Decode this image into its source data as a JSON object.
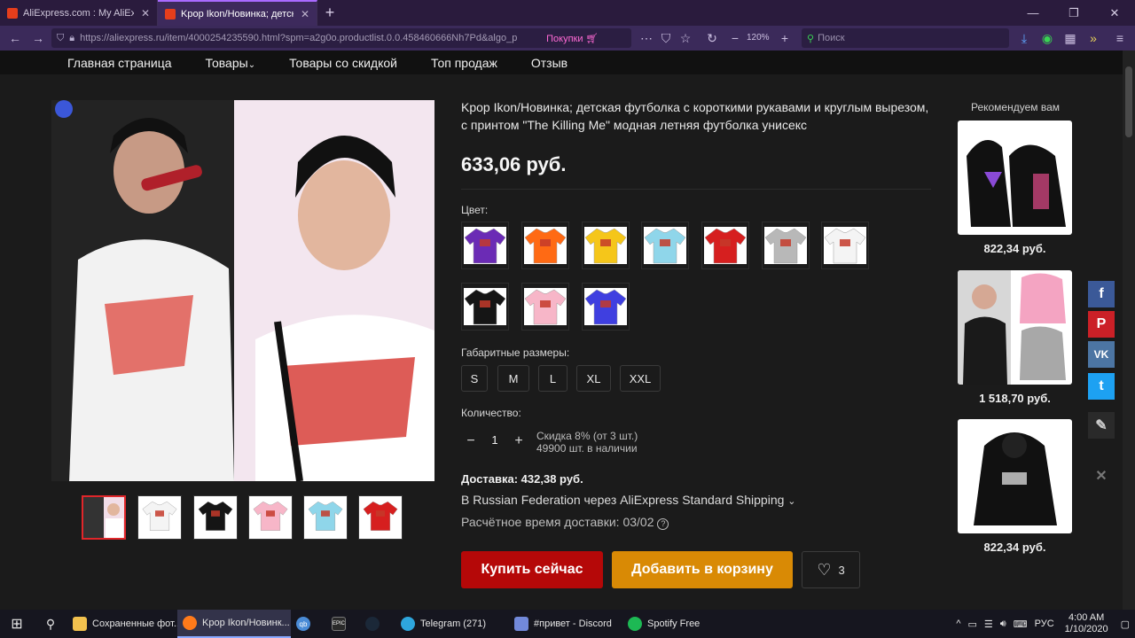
{
  "browser": {
    "tabs": [
      {
        "label": "AliExpress.com : My AliExpress"
      },
      {
        "label": "Kpop Ikon/Новинка; детская ф"
      }
    ],
    "url": "https://aliexpress.ru/item/4000254235590.html?spm=a2g0o.productlist.0.0.458460666Nh7Pd&algo_p",
    "shop_label": "Покупки",
    "zoom": "120%",
    "search_placeholder": "Поиск"
  },
  "site_nav": {
    "items": [
      "Главная страница",
      "Товары",
      "Товары со скидкой",
      "Топ продаж",
      "Отзыв"
    ]
  },
  "product": {
    "title": "Kpop Ikon/Новинка; детская футболка с короткими рукавами и круглым вырезом, с принтом \"The Killing Me\" модная летняя футболка унисекс",
    "price": "633,06 руб.",
    "color_label": "Цвет:",
    "colors": [
      "#6b2bb5",
      "#ff6a14",
      "#f5c61a",
      "#8fd6ea",
      "#d61f1f",
      "#b8b8b8",
      "#f4f4f4",
      "#151515",
      "#f7b6c8",
      "#3f3fe0"
    ],
    "size_label": "Габаритные размеры:",
    "sizes": [
      "S",
      "M",
      "L",
      "XL",
      "XXL"
    ],
    "qty_label": "Количество:",
    "qty": "1",
    "discount_text": "Скидка 8% (от 3 шт.)",
    "stock_text": "49900 шт. в наличии",
    "shipping_cost": "Доставка: 432,38 руб.",
    "shipping_via": "В Russian Federation через AliExpress Standard Shipping",
    "eta_label": "Расчётное время доставки: 03/02",
    "buy_now": "Купить сейчас",
    "add_to_cart": "Добавить в корзину",
    "wishlist_count": "3",
    "thumb_colors": [
      "#f4f4f4",
      "#151515",
      "#f7b6c8",
      "#8fd6ea",
      "#d61f1f"
    ]
  },
  "recommendations": {
    "title": "Рекомендуем вам",
    "items": [
      {
        "price": "822,34 руб."
      },
      {
        "price": "1 518,70 руб."
      },
      {
        "price": "822,34 руб."
      }
    ]
  },
  "taskbar": {
    "items": [
      {
        "label": "Сохраненные фот..."
      },
      {
        "label": "Kpop Ikon/Новинк..."
      },
      {
        "label": "qb"
      },
      {
        "label": "EPIC"
      },
      {
        "label": "Steam"
      },
      {
        "label": "Telegram (271)"
      },
      {
        "label": "#привет - Discord"
      },
      {
        "label": "Spotify Free"
      }
    ],
    "telegram_badge": "271",
    "lang": "РУС",
    "time": "4:00 AM",
    "date": "1/10/2020"
  }
}
